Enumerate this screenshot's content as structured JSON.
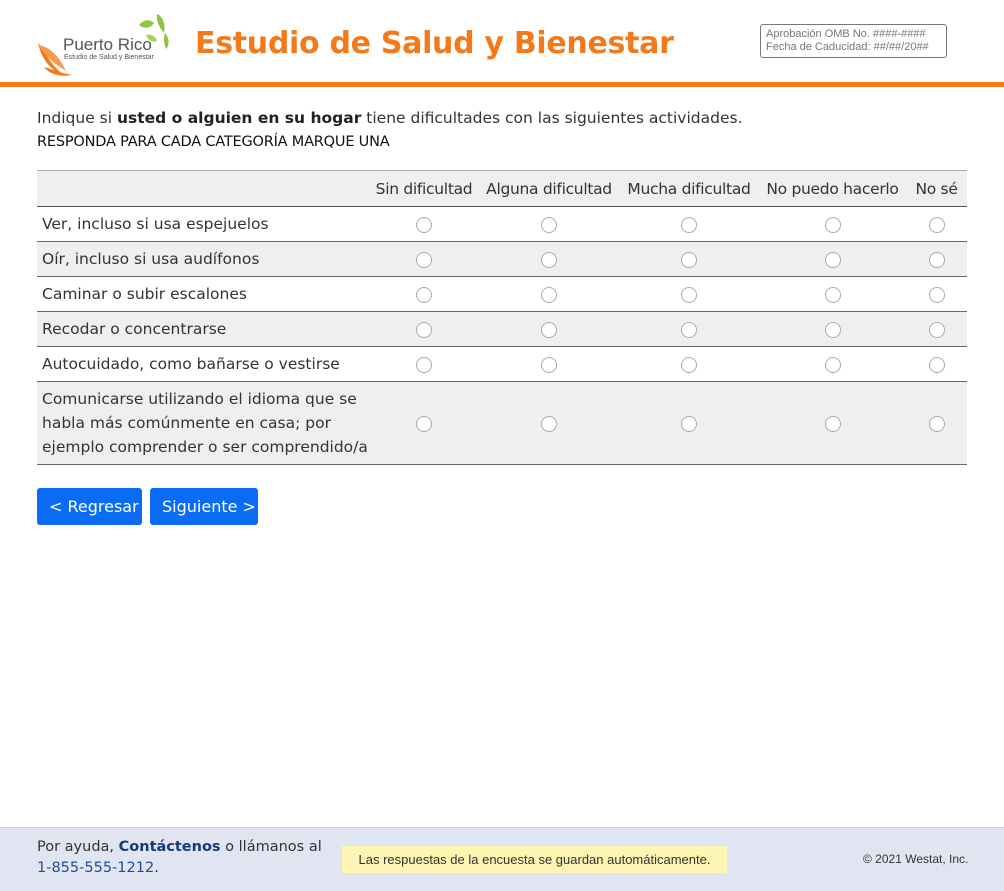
{
  "header": {
    "logo_line1": "Puerto Rico",
    "logo_line2": "Estudio de Salud y Bienestar",
    "title": "Estudio de Salud y Bienestar",
    "omb_line1": "Aprobación OMB No. ####-####",
    "omb_line2": "Fecha de Caducidad: ##/##/20##"
  },
  "instructions": {
    "text_before": "Indique si ",
    "text_bold": "usted o alguien en su hogar",
    "text_after": " tiene dificultades con las siguientes actividades.",
    "subtext": "RESPONDA PARA CADA CATEGORÍA MARQUE UNA"
  },
  "grid": {
    "columns": [
      "Sin dificultad",
      "Alguna dificultad",
      "Mucha dificultad",
      "No puedo hacerlo",
      "No sé"
    ],
    "rows": [
      {
        "label": "Ver, incluso si usa espejuelos"
      },
      {
        "label": "Oír, incluso si usa audífonos"
      },
      {
        "label": "Caminar o subir escalones"
      },
      {
        "label": "Recodar o concentrarse"
      },
      {
        "label": "Autocuidado, como bañarse o vestirse"
      },
      {
        "label": "Comunicarse utilizando el idioma que se habla más comúnmente en casa; por ejemplo comprender o ser comprendido/a"
      }
    ]
  },
  "nav": {
    "back_label": "< Regresar",
    "next_label": "Siguiente >"
  },
  "footer": {
    "help_prefix": "Por ayuda, ",
    "contact_link": "Contáctenos",
    "help_middle": " o llámanos al",
    "phone": "1-855-555-1212",
    "phone_suffix": ".",
    "saved_notice": "Las respuestas de la encuesta se guardan automáticamente.",
    "copyright": "© 2021 Westat, Inc."
  },
  "colors": {
    "accent_orange": "#f27a1a",
    "button_blue": "#0a6cf5",
    "logo_green": "#8dc63f",
    "footer_bg": "#e1e5f1",
    "notice_bg": "#fdf6b3"
  }
}
